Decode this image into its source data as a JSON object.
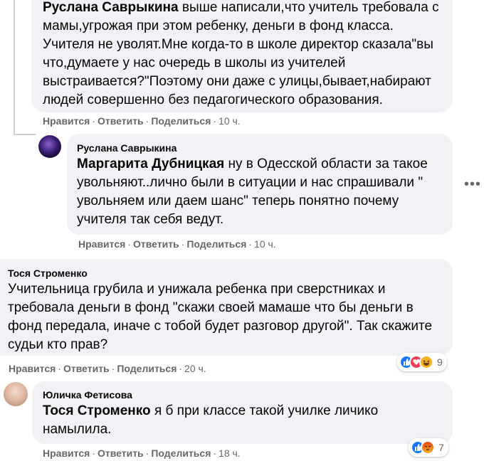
{
  "comments": [
    {
      "author": "Руслана Саврыкина",
      "lines": [
        "выше написали,что учитель требовала с",
        "мамы,угрожая при этом ребенку, деньги в фонд класса.",
        "Учителя не уволят.Мне когда-то в школе директор сказала\"вы",
        "что,думаете у нас очередь в школы из учителей",
        "выстраивается?\"Поэтому они даже с улицы,бывает,набирают",
        "людей совершенно без педагогического образования."
      ],
      "actions": {
        "like": "Нравится",
        "reply": "Ответить",
        "share": "Поделиться",
        "time": "10 ч."
      }
    },
    {
      "author": "Руслана Саврыкина",
      "mention": "Маргарита Дубницкая",
      "lines": [
        "ну в Одесской области за такое",
        "увольняют..лично были в ситуации и нас спрашивали \"",
        "увольняем или даем шанс\" теперь понятно почему",
        "учителя так себя ведут."
      ],
      "actions": {
        "like": "Нравится",
        "reply": "Ответить",
        "share": "Поделиться",
        "time": "10 ч."
      },
      "more_icon": "more-horizontal-icon"
    },
    {
      "author": "Тося Строменко",
      "lines": [
        "Учительница грубила и унижала ребенка при сверстниках и",
        "требовала деньги в фонд \"скажи своей мамаше что бы деньги в",
        "фонд передала, иначе с тобой будет разговор другой\". Так скажите",
        "судьи кто прав?"
      ],
      "actions": {
        "like": "Нравится",
        "reply": "Ответить",
        "share": "Поделиться",
        "time": "20 ч."
      },
      "reactions": {
        "icons": [
          "like-reaction-icon",
          "love-reaction-icon",
          "haha-reaction-icon"
        ],
        "count": "9"
      }
    },
    {
      "author": "Юличка Фетисова",
      "mention": "Тося Строменко",
      "lines": [
        "я б при классе такой училке личико",
        "намылила."
      ],
      "actions": {
        "like": "Нравится",
        "reply": "Ответить",
        "share": "Поделиться",
        "time": "18 ч."
      },
      "reactions": {
        "icons": [
          "like-reaction-icon",
          "angry-reaction-icon"
        ],
        "count": "7"
      }
    }
  ],
  "colors": {
    "bubble": "#f0f2f5",
    "meta": "#65676b",
    "like": "#1877f2",
    "love": "#f33e58",
    "haha": "#f7b125",
    "angry": "#e9710f"
  }
}
